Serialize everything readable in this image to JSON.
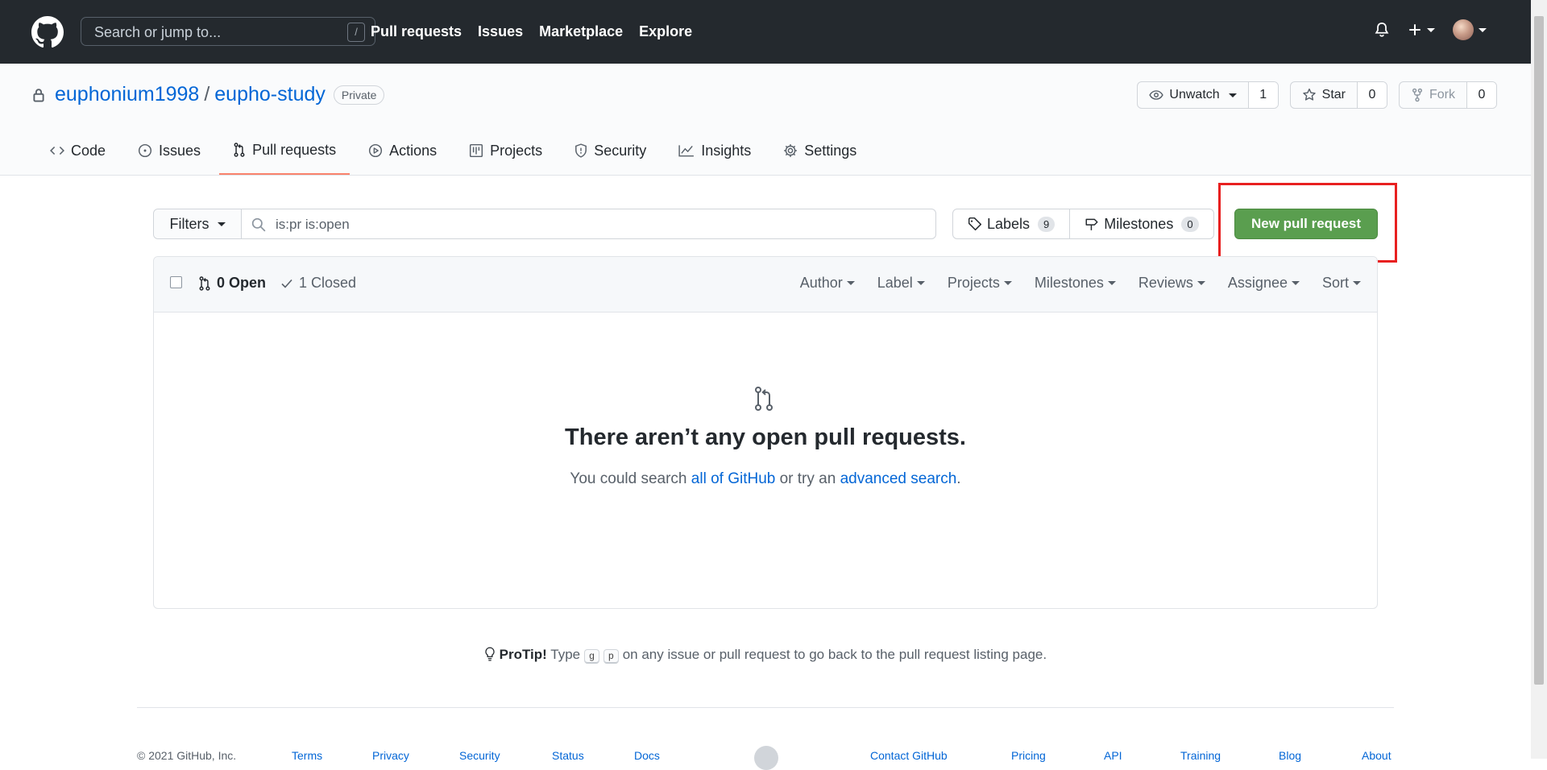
{
  "header": {
    "search_placeholder": "Search or jump to...",
    "slash_key": "/",
    "nav": [
      "Pull requests",
      "Issues",
      "Marketplace",
      "Explore"
    ]
  },
  "repo": {
    "owner": "euphonium1998",
    "separator": "/",
    "name": "eupho-study",
    "visibility": "Private",
    "watch_label": "Unwatch",
    "watch_count": "1",
    "star_label": "Star",
    "star_count": "0",
    "fork_label": "Fork",
    "fork_count": "0"
  },
  "tabs": [
    {
      "label": "Code",
      "icon": "code-icon"
    },
    {
      "label": "Issues",
      "icon": "issue-icon"
    },
    {
      "label": "Pull requests",
      "icon": "pull-request-icon",
      "active": true
    },
    {
      "label": "Actions",
      "icon": "play-icon"
    },
    {
      "label": "Projects",
      "icon": "project-icon"
    },
    {
      "label": "Security",
      "icon": "shield-icon"
    },
    {
      "label": "Insights",
      "icon": "graph-icon"
    },
    {
      "label": "Settings",
      "icon": "gear-icon"
    }
  ],
  "subnav": {
    "filters_label": "Filters",
    "search_value": "is:pr is:open",
    "labels_label": "Labels",
    "labels_count": "9",
    "milestones_label": "Milestones",
    "milestones_count": "0",
    "new_pr_label": "New pull request"
  },
  "list": {
    "open_label": "0 Open",
    "closed_label": "1 Closed",
    "menus": [
      "Author",
      "Label",
      "Projects",
      "Milestones",
      "Reviews",
      "Assignee",
      "Sort"
    ]
  },
  "blank": {
    "title": "There aren’t any open pull requests.",
    "text_before": "You could search ",
    "link_all": "all of GitHub",
    "text_middle": " or try an ",
    "link_advanced": "advanced search",
    "text_after": "."
  },
  "protip": {
    "label": "ProTip!",
    "before": " Type ",
    "key1": "g",
    "key2": "p",
    "after": " on any issue or pull request to go back to the pull request listing page."
  },
  "footer": {
    "copyright": "© 2021 GitHub, Inc.",
    "links": [
      "Terms",
      "Privacy",
      "Security",
      "Status",
      "Docs",
      "Contact GitHub",
      "Pricing",
      "API",
      "Training",
      "Blog",
      "About"
    ]
  },
  "colors": {
    "header_bg": "#24292e",
    "link": "#0366d6",
    "primary_button": "#5a9e4f",
    "active_tab_underline": "#f9826c",
    "annotation_box": "#e82020"
  }
}
